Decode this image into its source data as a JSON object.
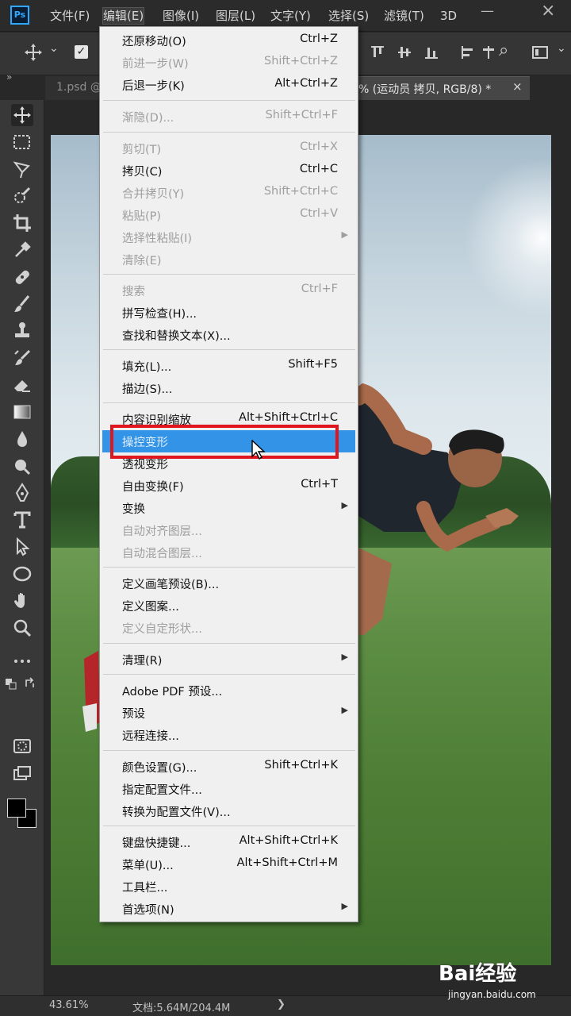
{
  "app": {
    "logo": "Ps",
    "menus": [
      "文件(F)",
      "编辑(E)",
      "图像(I)",
      "图层(L)",
      "文字(Y)",
      "选择(S)",
      "滤镜(T)",
      "3D"
    ],
    "window_controls": {
      "minimize": "—",
      "close": "×"
    }
  },
  "options_bar": {
    "move_icon": "move-tool-icon",
    "dropdown_arrow": "⌄",
    "auto_select_checked": true,
    "check_mark": "✓",
    "search_icon": "⌕"
  },
  "tabs": {
    "collapse": "»",
    "left_tab": "1.psd @",
    "active_tab": "% (运动员 拷贝, RGB/8) *",
    "close": "×"
  },
  "edit_menu": {
    "items": [
      {
        "label": "还原移动(O)",
        "shortcut": "Ctrl+Z",
        "disabled": false
      },
      {
        "label": "前进一步(W)",
        "shortcut": "Shift+Ctrl+Z",
        "disabled": true
      },
      {
        "label": "后退一步(K)",
        "shortcut": "Alt+Ctrl+Z",
        "disabled": false
      },
      {
        "label": "渐隐(D)...",
        "shortcut": "Shift+Ctrl+F",
        "disabled": true
      },
      {
        "label": "剪切(T)",
        "shortcut": "Ctrl+X",
        "disabled": true
      },
      {
        "label": "拷贝(C)",
        "shortcut": "Ctrl+C",
        "disabled": false
      },
      {
        "label": "合并拷贝(Y)",
        "shortcut": "Shift+Ctrl+C",
        "disabled": true
      },
      {
        "label": "粘贴(P)",
        "shortcut": "Ctrl+V",
        "disabled": true
      },
      {
        "label": "选择性粘贴(I)",
        "shortcut": "",
        "disabled": true,
        "submenu": true
      },
      {
        "label": "清除(E)",
        "shortcut": "",
        "disabled": true
      },
      {
        "label": "搜索",
        "shortcut": "Ctrl+F",
        "disabled": true
      },
      {
        "label": "拼写检查(H)...",
        "shortcut": "",
        "disabled": false
      },
      {
        "label": "查找和替换文本(X)...",
        "shortcut": "",
        "disabled": false
      },
      {
        "label": "填充(L)...",
        "shortcut": "Shift+F5",
        "disabled": false
      },
      {
        "label": "描边(S)...",
        "shortcut": "",
        "disabled": false
      },
      {
        "label": "内容识别缩放",
        "shortcut": "Alt+Shift+Ctrl+C",
        "disabled": false
      },
      {
        "label": "操控变形",
        "shortcut": "",
        "disabled": false,
        "hover": true
      },
      {
        "label": "透视变形",
        "shortcut": "",
        "disabled": false
      },
      {
        "label": "自由变换(F)",
        "shortcut": "Ctrl+T",
        "disabled": false
      },
      {
        "label": "变换",
        "shortcut": "",
        "disabled": false,
        "submenu": true
      },
      {
        "label": "自动对齐图层...",
        "shortcut": "",
        "disabled": true
      },
      {
        "label": "自动混合图层...",
        "shortcut": "",
        "disabled": true
      },
      {
        "label": "定义画笔预设(B)...",
        "shortcut": "",
        "disabled": false
      },
      {
        "label": "定义图案...",
        "shortcut": "",
        "disabled": false
      },
      {
        "label": "定义自定形状...",
        "shortcut": "",
        "disabled": true
      },
      {
        "label": "清理(R)",
        "shortcut": "",
        "disabled": false,
        "submenu": true
      },
      {
        "label": "Adobe PDF 预设...",
        "shortcut": "",
        "disabled": false
      },
      {
        "label": "预设",
        "shortcut": "",
        "disabled": false,
        "submenu": true
      },
      {
        "label": "远程连接...",
        "shortcut": "",
        "disabled": false
      },
      {
        "label": "颜色设置(G)...",
        "shortcut": "Shift+Ctrl+K",
        "disabled": false
      },
      {
        "label": "指定配置文件...",
        "shortcut": "",
        "disabled": false
      },
      {
        "label": "转换为配置文件(V)...",
        "shortcut": "",
        "disabled": false
      },
      {
        "label": "键盘快捷键...",
        "shortcut": "Alt+Shift+Ctrl+K",
        "disabled": false
      },
      {
        "label": "菜单(U)...",
        "shortcut": "Alt+Shift+Ctrl+M",
        "disabled": false
      },
      {
        "label": "工具栏...",
        "shortcut": "",
        "disabled": false
      },
      {
        "label": "首选项(N)",
        "shortcut": "",
        "disabled": false,
        "submenu": true
      }
    ],
    "submenu_arrow": "▶"
  },
  "status": {
    "zoom": "43.61%",
    "doc_info": "文档:5.64M/204.4M",
    "arrow": "❯"
  },
  "watermark": {
    "logo": "Bai经验",
    "url": "jingyan.baidu.com"
  },
  "colors": {
    "accent": "#3393e6",
    "highlight_box": "#e0161f",
    "ps_blue": "#31a8ff"
  },
  "toolbar_icons": [
    "move-icon",
    "marquee-icon",
    "lasso-icon",
    "quick-select-icon",
    "crop-icon",
    "eyedropper-icon",
    "healing-icon",
    "brush-icon",
    "stamp-icon",
    "history-brush-icon",
    "eraser-icon",
    "gradient-icon",
    "blur-icon",
    "dodge-icon",
    "pen-icon",
    "type-icon",
    "path-select-icon",
    "ellipse-icon",
    "hand-icon",
    "zoom-icon",
    "more-tools-icon",
    "default-colors-icon",
    "swap-colors-icon",
    "quick-mask-icon",
    "screen-mode-icon"
  ]
}
